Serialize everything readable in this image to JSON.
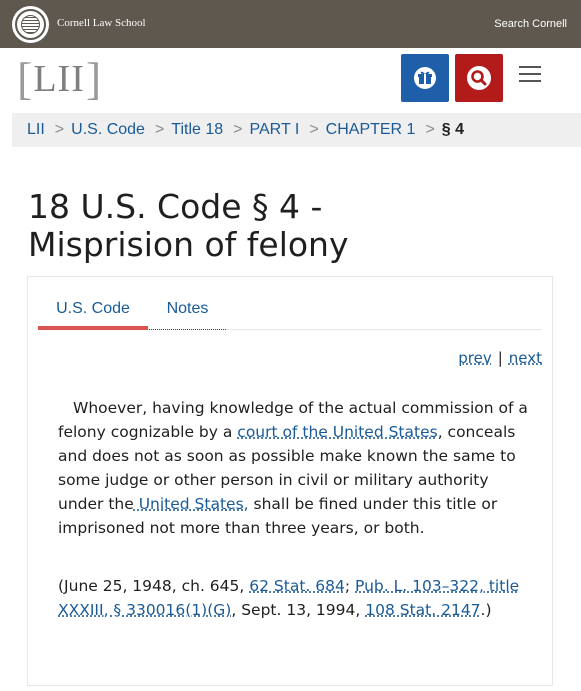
{
  "header": {
    "school_name": "Cornell Law School",
    "search_link": "Search Cornell"
  },
  "logo": {
    "bracket_open": "[",
    "text": "LII",
    "bracket_close": "]"
  },
  "icons": {
    "gift": "gift-icon",
    "search": "search-icon",
    "menu": "hamburger-menu-icon",
    "seal": "cornell-seal-icon"
  },
  "breadcrumb": {
    "items": [
      "LII",
      "U.S. Code",
      "Title 18",
      "PART I",
      "CHAPTER 1"
    ],
    "separator": ">",
    "current": "§ 4"
  },
  "page": {
    "title_line1": "18 U.S. Code § 4 -",
    "title_line2": "Misprision of felony"
  },
  "tabs": [
    {
      "label": "U.S. Code",
      "active": true
    },
    {
      "label": "Notes",
      "active": false
    }
  ],
  "pager": {
    "prev": "prev",
    "divider": "|",
    "next": "next"
  },
  "body": {
    "part1": "Whoever, having knowledge of the actual commission of a felony cognizable by a ",
    "link1": "court of the United States",
    "part2": ", conceals and does not as soon as possible make known the same to some judge or other person in civil or military authority under the",
    "link2": " United States,",
    "part3": " shall be fined under this title or imprisoned not more than three years, or both."
  },
  "citation": {
    "p1": "(June 25, 1948, ch. 645, ",
    "l1": "62 Stat. 684",
    "p2": "; ",
    "l2": "Pub. L. 103–322, title XXXIII, § 330016(1)(G)",
    "p3": ", Sept. 13, 1994, ",
    "l3": "108 Stat. 2147",
    "p4": ".)"
  },
  "colors": {
    "topbar": "#5f584f",
    "link": "#1a5a96",
    "gift_button": "#1f5ea8",
    "search_button": "#b31b1b",
    "active_tab": "#d9534f"
  }
}
